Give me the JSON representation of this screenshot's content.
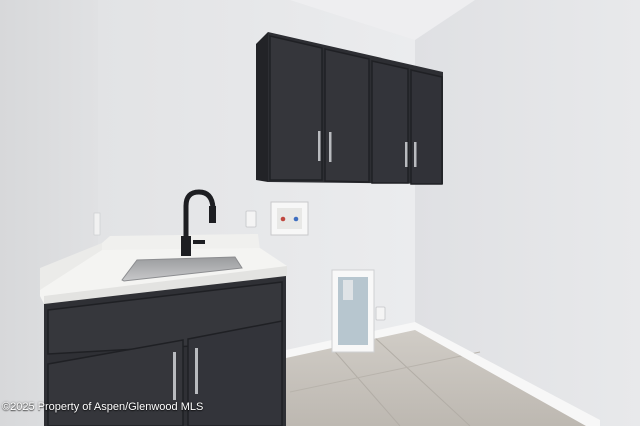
{
  "photo": {
    "subject": "laundry room with sink base cabinet and upper wall cabinets",
    "colors": {
      "wall_left": "#dfe0e2",
      "wall_back": "#e6e7e9",
      "wall_right": "#e4e5e7",
      "ceiling": "#ececee",
      "cabinet": "#2f3035",
      "cabinet_edge": "#24252a",
      "countertop": "#f3f3f1",
      "floor": "#c8c4be",
      "baseboard": "#fafafa"
    }
  },
  "watermark": {
    "text": "©2025 Property of Aspen/Glenwood MLS"
  }
}
